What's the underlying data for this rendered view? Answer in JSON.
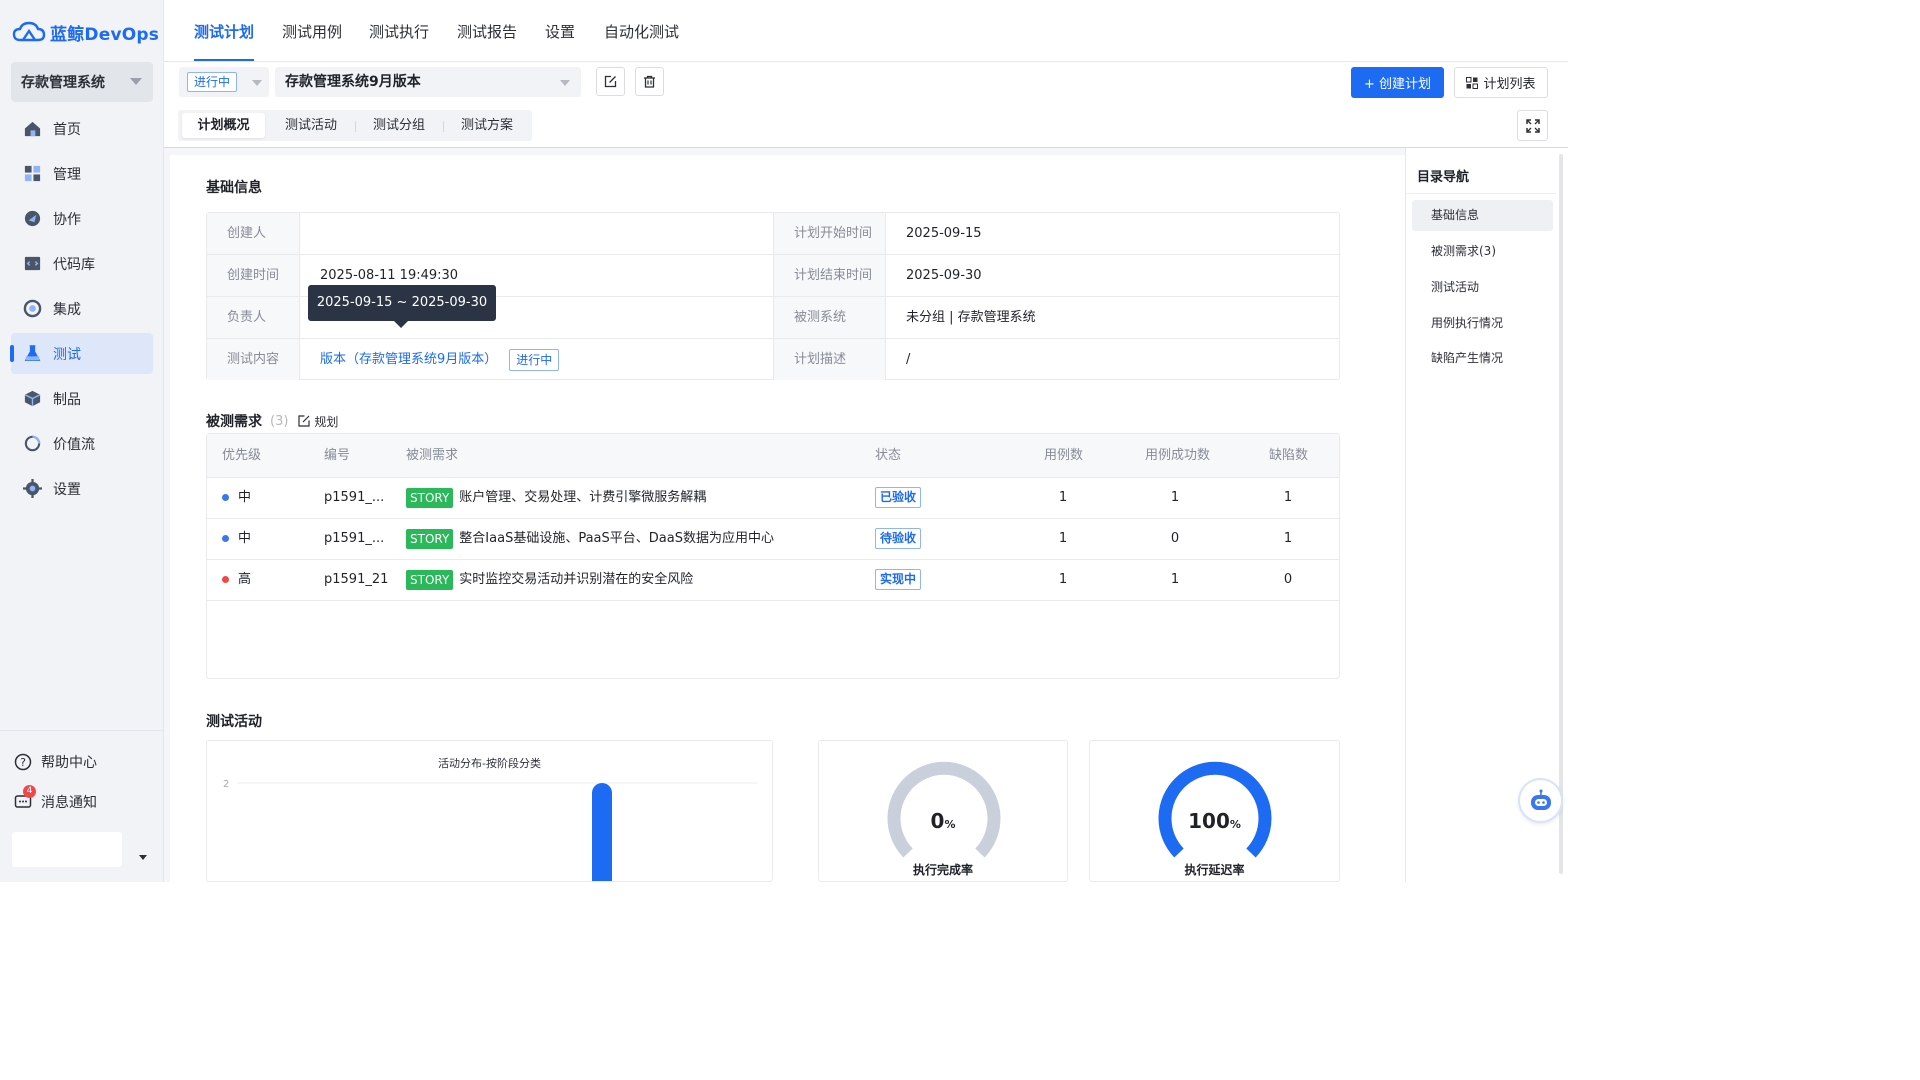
{
  "brand": {
    "name": "蓝鲸DevOps"
  },
  "sidebar": {
    "project": "存款管理系统",
    "items": [
      {
        "label": "首页",
        "icon": "home-icon"
      },
      {
        "label": "管理",
        "icon": "manage-icon"
      },
      {
        "label": "协作",
        "icon": "collaborate-icon"
      },
      {
        "label": "代码库",
        "icon": "code-repo-icon"
      },
      {
        "label": "集成",
        "icon": "integration-icon"
      },
      {
        "label": "测试",
        "icon": "test-flask-icon",
        "active": true
      },
      {
        "label": "制品",
        "icon": "artifact-cube-icon"
      },
      {
        "label": "价值流",
        "icon": "value-stream-icon"
      },
      {
        "label": "设置",
        "icon": "settings-gear-icon"
      }
    ],
    "help": "帮助中心",
    "notify": "消息通知",
    "notify_count": "4"
  },
  "topnav": {
    "tabs": [
      "测试计划",
      "测试用例",
      "测试执行",
      "测试报告",
      "设置",
      "自动化测试"
    ],
    "active": "测试计划"
  },
  "toolbar": {
    "status": "进行中",
    "plan_name": "存款管理系统9月版本",
    "create_plan": "+ 创建计划",
    "plan_list": "计划列表"
  },
  "subtabs": [
    "计划概况",
    "测试活动",
    "测试分组",
    "测试方案"
  ],
  "basic_info": {
    "title": "基础信息",
    "creator_label": "创建人",
    "creator": "",
    "created_label": "创建时间",
    "created": "2025-08-11 19:49:30",
    "owner_label": "负责人",
    "content_label": "测试内容",
    "content_link": "版本（存款管理系统9月版本）",
    "content_status": "进行中",
    "start_label": "计划开始时间",
    "start": "2025-09-15",
    "end_label": "计划结束时间",
    "end": "2025-09-30",
    "system_label": "被测系统",
    "system": "未分组 | 存款管理系统",
    "desc_label": "计划描述",
    "desc": "/",
    "tooltip": "2025-09-15 ~ 2025-09-30"
  },
  "requirements": {
    "title": "被测需求",
    "count": "(3)",
    "plan_link": "规划",
    "columns": [
      "优先级",
      "编号",
      "被测需求",
      "状态",
      "用例数",
      "用例成功数",
      "缺陷数"
    ],
    "rows": [
      {
        "priority": "中",
        "priority_color": "#3a76f0",
        "id": "p1591_...",
        "type": "STORY",
        "name": "账户管理、交易处理、计费引擎微服务解耦",
        "state": "已验收",
        "cases": "1",
        "success": "1",
        "defects": "1"
      },
      {
        "priority": "中",
        "priority_color": "#3a76f0",
        "id": "p1591_...",
        "type": "STORY",
        "name": "整合IaaS基础设施、PaaS平台、DaaS数据为应用中心",
        "state": "待验收",
        "cases": "1",
        "success": "0",
        "defects": "1"
      },
      {
        "priority": "高",
        "priority_color": "#f04848",
        "id": "p1591_21",
        "type": "STORY",
        "name": "实时监控交易活动并识别潜在的安全风险",
        "state": "实现中",
        "cases": "1",
        "success": "1",
        "defects": "0"
      }
    ]
  },
  "activity": {
    "title": "测试活动",
    "chart_title": "活动分布-按阶段分类",
    "completion_label": "执行完成率",
    "completion_value": "0",
    "delay_label": "执行延迟率",
    "delay_value": "100",
    "percent": "%"
  },
  "chart_data": {
    "type": "bar",
    "title": "活动分布-按阶段分类",
    "categories": [
      ""
    ],
    "values": [
      2
    ],
    "ylim": [
      0,
      2
    ],
    "ytick_labels": [
      "2"
    ],
    "color": "#1d6bf2"
  },
  "toc": {
    "title": "目录导航",
    "items": [
      "基础信息",
      "被测需求(3)",
      "测试活动",
      "用例执行情况",
      "缺陷产生情况"
    ]
  },
  "colors": {
    "accent": "#1d6bf2",
    "story": "#2ab85a",
    "high": "#f04848",
    "medium": "#3a76f0"
  }
}
